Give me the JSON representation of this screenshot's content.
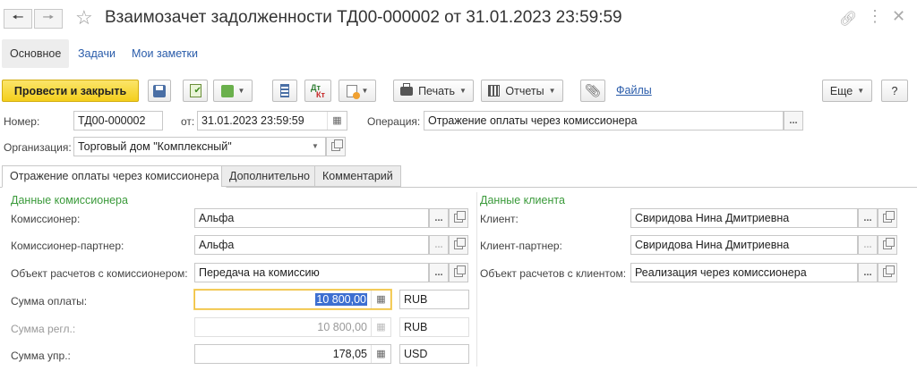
{
  "window": {
    "title": "Взаимозачет задолженности ТД00-000002 от 31.01.2023 23:59:59",
    "back_icon": "arrow-left-icon",
    "forward_icon": "arrow-right-icon",
    "favorite_icon": "star-icon",
    "link_icon": "link-icon",
    "more_icon": "more-vertical-icon",
    "close_icon": "close-icon"
  },
  "top_tabs": [
    {
      "label": "Основное",
      "active": true
    },
    {
      "label": "Задачи",
      "active": false
    },
    {
      "label": "Мои заметки",
      "active": false
    }
  ],
  "toolbar": {
    "post_close_label": "Провести и закрыть",
    "print_label": "Печать",
    "reports_label": "Отчеты",
    "files_label": "Файлы",
    "more_label": "Еще",
    "help_label": "?",
    "dtkt_top": "Дт",
    "dtkt_bottom": "Кт"
  },
  "header": {
    "number_label": "Номер:",
    "number_value": "ТД00-000002",
    "date_label": "от:",
    "date_value": "31.01.2023 23:59:59",
    "operation_label": "Операция:",
    "operation_value": "Отражение оплаты через комиссионера",
    "org_label": "Организация:",
    "org_value": "Торговый дом \"Комплексный\""
  },
  "sub_tabs": [
    {
      "label": "Отражение оплаты через комиссионера",
      "active": true
    },
    {
      "label": "Дополнительно",
      "active": false
    },
    {
      "label": "Комментарий",
      "active": false
    }
  ],
  "left": {
    "group_title": "Данные комиссионера",
    "commissioner_label": "Комиссионер:",
    "commissioner_value": "Альфа",
    "partner_label": "Комиссионер-партнер:",
    "partner_value": "Альфа",
    "settlement_label": "Объект расчетов с комиссионером:",
    "settlement_value": "Передача на комиссию",
    "payment_label": "Сумма оплаты:",
    "payment_value": "10 800,00",
    "payment_currency": "RUB",
    "reg_label": "Сумма регл.:",
    "reg_value": "10 800,00",
    "reg_currency": "RUB",
    "mgmt_label": "Сумма упр.:",
    "mgmt_value": "178,05",
    "mgmt_currency": "USD"
  },
  "right": {
    "group_title": "Данные клиента",
    "client_label": "Клиент:",
    "client_value": "Свиридова Нина Дмитриевна",
    "client_partner_label": "Клиент-партнер:",
    "client_partner_value": "Свиридова Нина Дмитриевна",
    "client_settlement_label": "Объект расчетов с клиентом:",
    "client_settlement_value": "Реализация через комиссионера"
  },
  "colors": {
    "primary_button": "#f4cf1c",
    "group_title": "#3a9a3a",
    "link": "#2a5caa",
    "selection": "#3d6fd1"
  }
}
